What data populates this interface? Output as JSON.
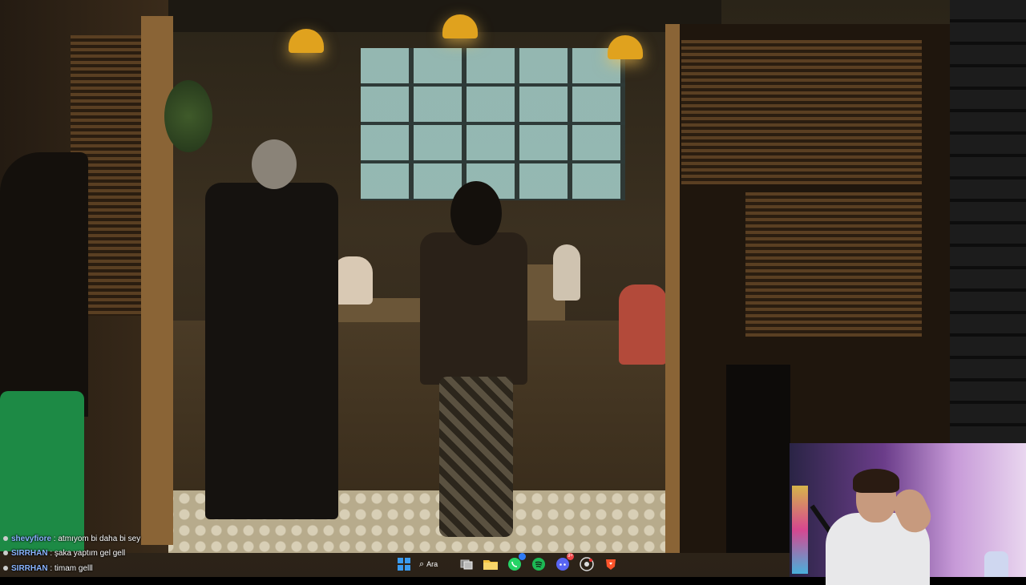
{
  "chat": {
    "messages": [
      {
        "user": "shevyfiore",
        "text": " : atmıyom bi daha bi sey"
      },
      {
        "user": "SIRRHAN",
        "text": " : şaka yaptım gel gell"
      },
      {
        "user": "SIRRHAN",
        "text": " : timam gelll"
      }
    ]
  },
  "taskbar": {
    "search_label": "Ara",
    "icons": [
      "windows-start-icon",
      "search-icon",
      "task-view-icon",
      "file-explorer-icon",
      "whatsapp-icon",
      "spotify-icon",
      "discord-icon",
      "chrome-icon",
      "brave-icon"
    ],
    "whatsapp_badge": "",
    "discord_badge": "9+"
  },
  "colors": {
    "chat_username": "#8ab4ff",
    "taskbar_start": "#3a9bf0",
    "whatsapp": "#25d366",
    "spotify": "#1db954",
    "discord": "#5865f2",
    "brave": "#fb542b",
    "folder": "#f3c23f"
  }
}
